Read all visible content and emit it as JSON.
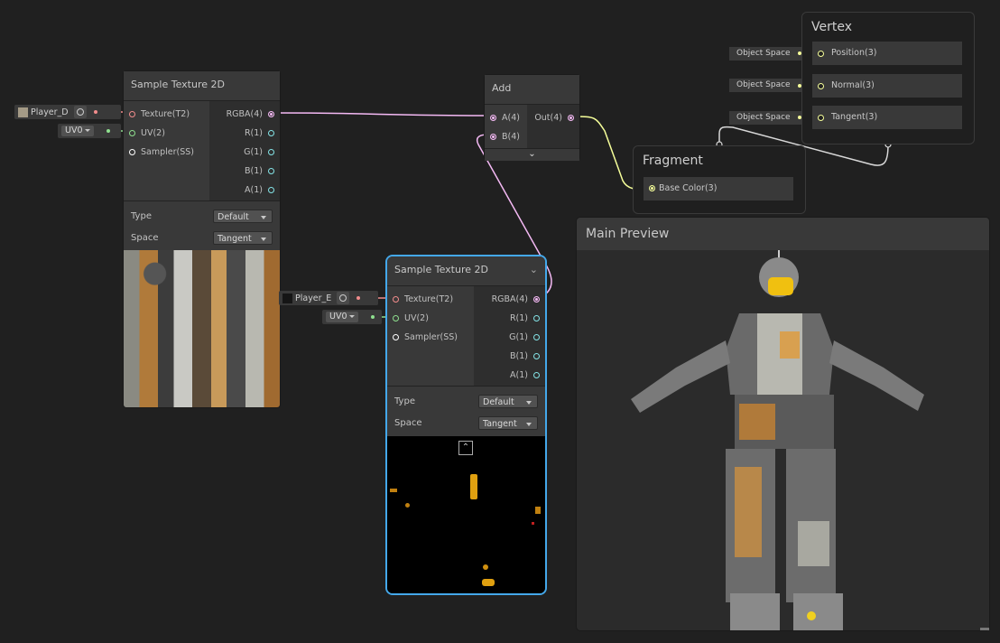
{
  "graph": {
    "nodes": {
      "sample_texture_1": {
        "title": "Sample Texture 2D",
        "inputs": [
          "Texture(T2)",
          "UV(2)",
          "Sampler(SS)"
        ],
        "outputs": [
          "RGBA(4)",
          "R(1)",
          "G(1)",
          "B(1)",
          "A(1)"
        ],
        "properties": [
          {
            "label": "Type",
            "value": "Default"
          },
          {
            "label": "Space",
            "value": "Tangent"
          }
        ],
        "texture_field": "Player_D",
        "uv_field": "UV0"
      },
      "sample_texture_2": {
        "title": "Sample Texture 2D",
        "inputs": [
          "Texture(T2)",
          "UV(2)",
          "Sampler(SS)"
        ],
        "outputs": [
          "RGBA(4)",
          "R(1)",
          "G(1)",
          "B(1)",
          "A(1)"
        ],
        "properties": [
          {
            "label": "Type",
            "value": "Default"
          },
          {
            "label": "Space",
            "value": "Tangent"
          }
        ],
        "texture_field": "Player_E",
        "uv_field": "UV0",
        "selected": true
      },
      "add": {
        "title": "Add",
        "inputs": [
          "A(4)",
          "B(4)"
        ],
        "outputs": [
          "Out(4)"
        ]
      },
      "vertex": {
        "title": "Vertex",
        "slots": [
          {
            "label": "Position(3)",
            "space": "Object Space"
          },
          {
            "label": "Normal(3)",
            "space": "Object Space"
          },
          {
            "label": "Tangent(3)",
            "space": "Object Space"
          }
        ]
      },
      "fragment": {
        "title": "Fragment",
        "slots": [
          {
            "label": "Base Color(3)"
          }
        ]
      }
    },
    "main_preview": {
      "title": "Main Preview"
    }
  },
  "colors": {
    "texture_port": "#f28c8c",
    "uv_port": "#8fe08f",
    "vector4_port": "#f4b9f4",
    "float_port": "#84e4e7",
    "vector3_port": "#f6ff9a",
    "selection": "#44a8ea",
    "background": "#202020"
  }
}
